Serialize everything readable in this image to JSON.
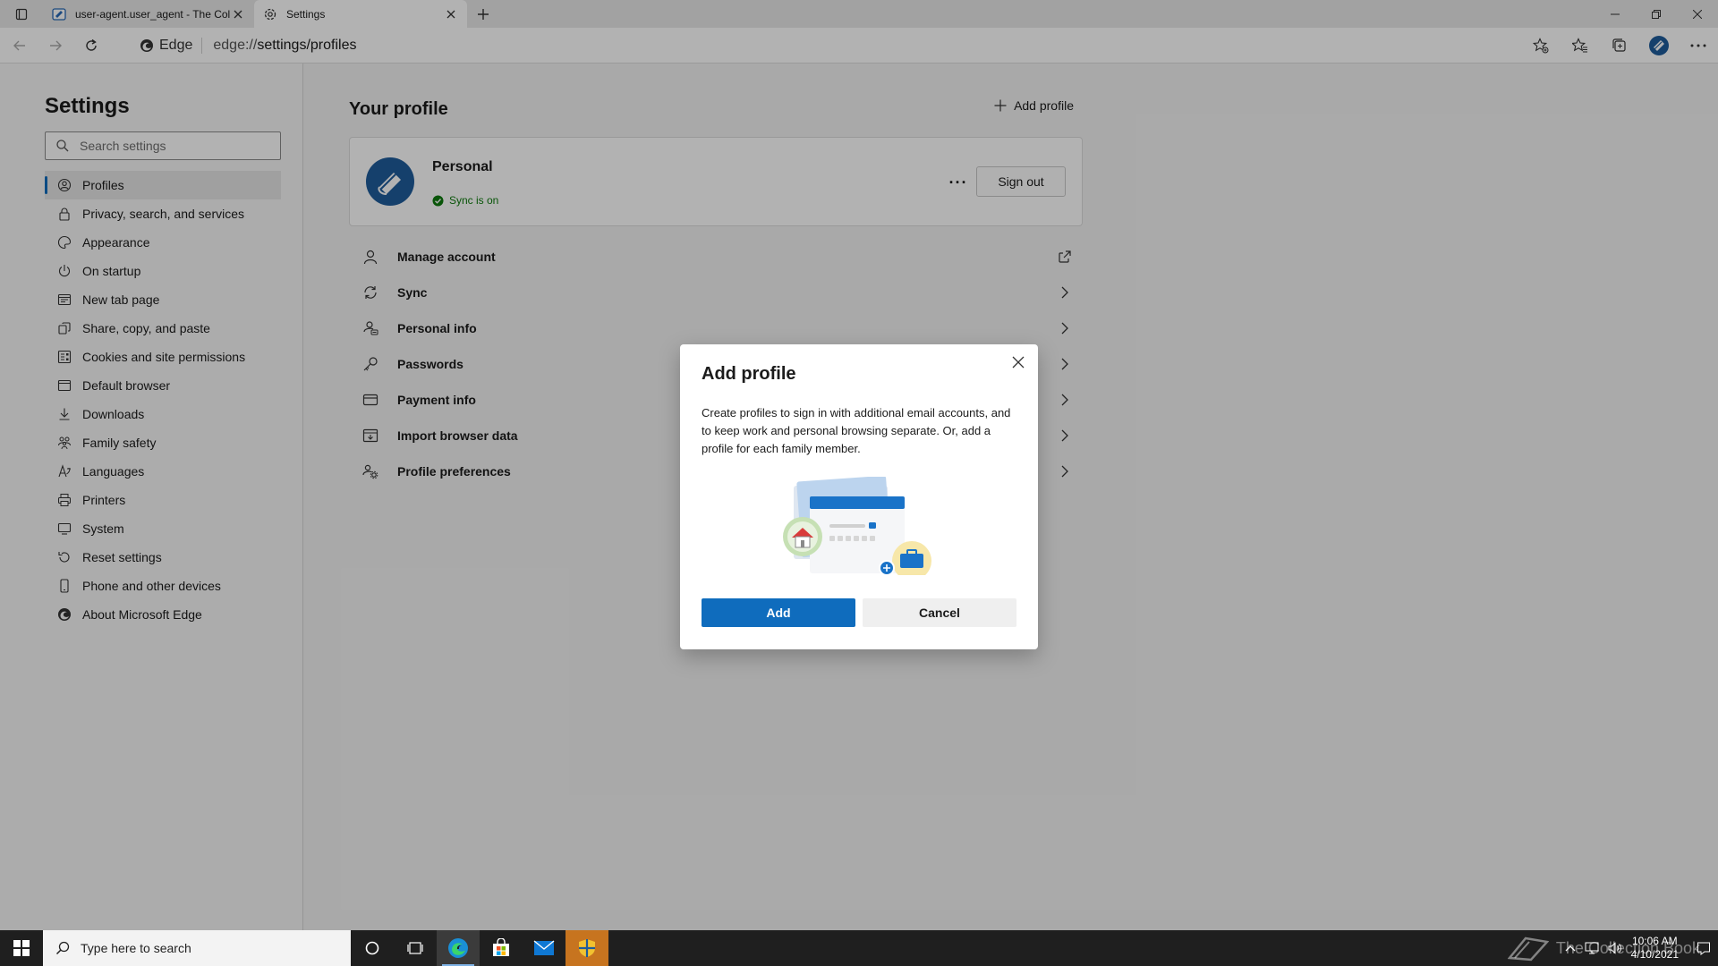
{
  "browser": {
    "tabs": [
      {
        "title": "user-agent.user_agent - The Coll",
        "icon": "book-favicon"
      },
      {
        "title": "Settings",
        "icon": "gear-icon"
      }
    ],
    "address": {
      "chip_label": "Edge",
      "url_prefix": "edge://",
      "url_path": "settings/profiles"
    }
  },
  "sidebar": {
    "title": "Settings",
    "search_placeholder": "Search settings",
    "items": [
      {
        "label": "Profiles",
        "icon": "profile-icon",
        "active": true
      },
      {
        "label": "Privacy, search, and services",
        "icon": "lock-icon"
      },
      {
        "label": "Appearance",
        "icon": "palette-icon"
      },
      {
        "label": "On startup",
        "icon": "power-icon"
      },
      {
        "label": "New tab page",
        "icon": "newtab-icon"
      },
      {
        "label": "Share, copy, and paste",
        "icon": "share-icon"
      },
      {
        "label": "Cookies and site permissions",
        "icon": "permissions-icon"
      },
      {
        "label": "Default browser",
        "icon": "browser-icon"
      },
      {
        "label": "Downloads",
        "icon": "download-icon"
      },
      {
        "label": "Family safety",
        "icon": "family-icon"
      },
      {
        "label": "Languages",
        "icon": "language-icon"
      },
      {
        "label": "Printers",
        "icon": "printer-icon"
      },
      {
        "label": "System",
        "icon": "system-icon"
      },
      {
        "label": "Reset settings",
        "icon": "reset-icon"
      },
      {
        "label": "Phone and other devices",
        "icon": "phone-icon"
      },
      {
        "label": "About Microsoft Edge",
        "icon": "edge-icon"
      }
    ]
  },
  "main": {
    "heading": "Your profile",
    "add_profile_label": "Add profile",
    "profile": {
      "name": "Personal",
      "sync_status": "Sync is on",
      "more_label": "···",
      "sign_out_label": "Sign out"
    },
    "rows": [
      {
        "label": "Manage account",
        "icon": "person-icon",
        "trailing": "external-link-icon"
      },
      {
        "label": "Sync",
        "icon": "sync-icon",
        "trailing": "chevron-right-icon"
      },
      {
        "label": "Personal info",
        "icon": "personal-info-icon",
        "trailing": "chevron-right-icon"
      },
      {
        "label": "Passwords",
        "icon": "key-icon",
        "trailing": "chevron-right-icon"
      },
      {
        "label": "Payment info",
        "icon": "card-icon",
        "trailing": "chevron-right-icon"
      },
      {
        "label": "Import browser data",
        "icon": "import-icon",
        "trailing": "chevron-right-icon"
      },
      {
        "label": "Profile preferences",
        "icon": "people-settings-icon",
        "trailing": "chevron-right-icon"
      }
    ]
  },
  "dialog": {
    "title": "Add profile",
    "body": "Create profiles to sign in with additional email accounts, and to keep work and personal browsing separate. Or, add a profile for each family member.",
    "primary_label": "Add",
    "secondary_label": "Cancel"
  },
  "taskbar": {
    "search_placeholder": "Type here to search",
    "time": "10:06 AM",
    "date": "4/10/2021",
    "watermark": "The Collection Book"
  },
  "colors": {
    "accent": "#0f6cbd",
    "sync_green": "#0e7a0d",
    "taskbar": "#1f1f1f"
  }
}
